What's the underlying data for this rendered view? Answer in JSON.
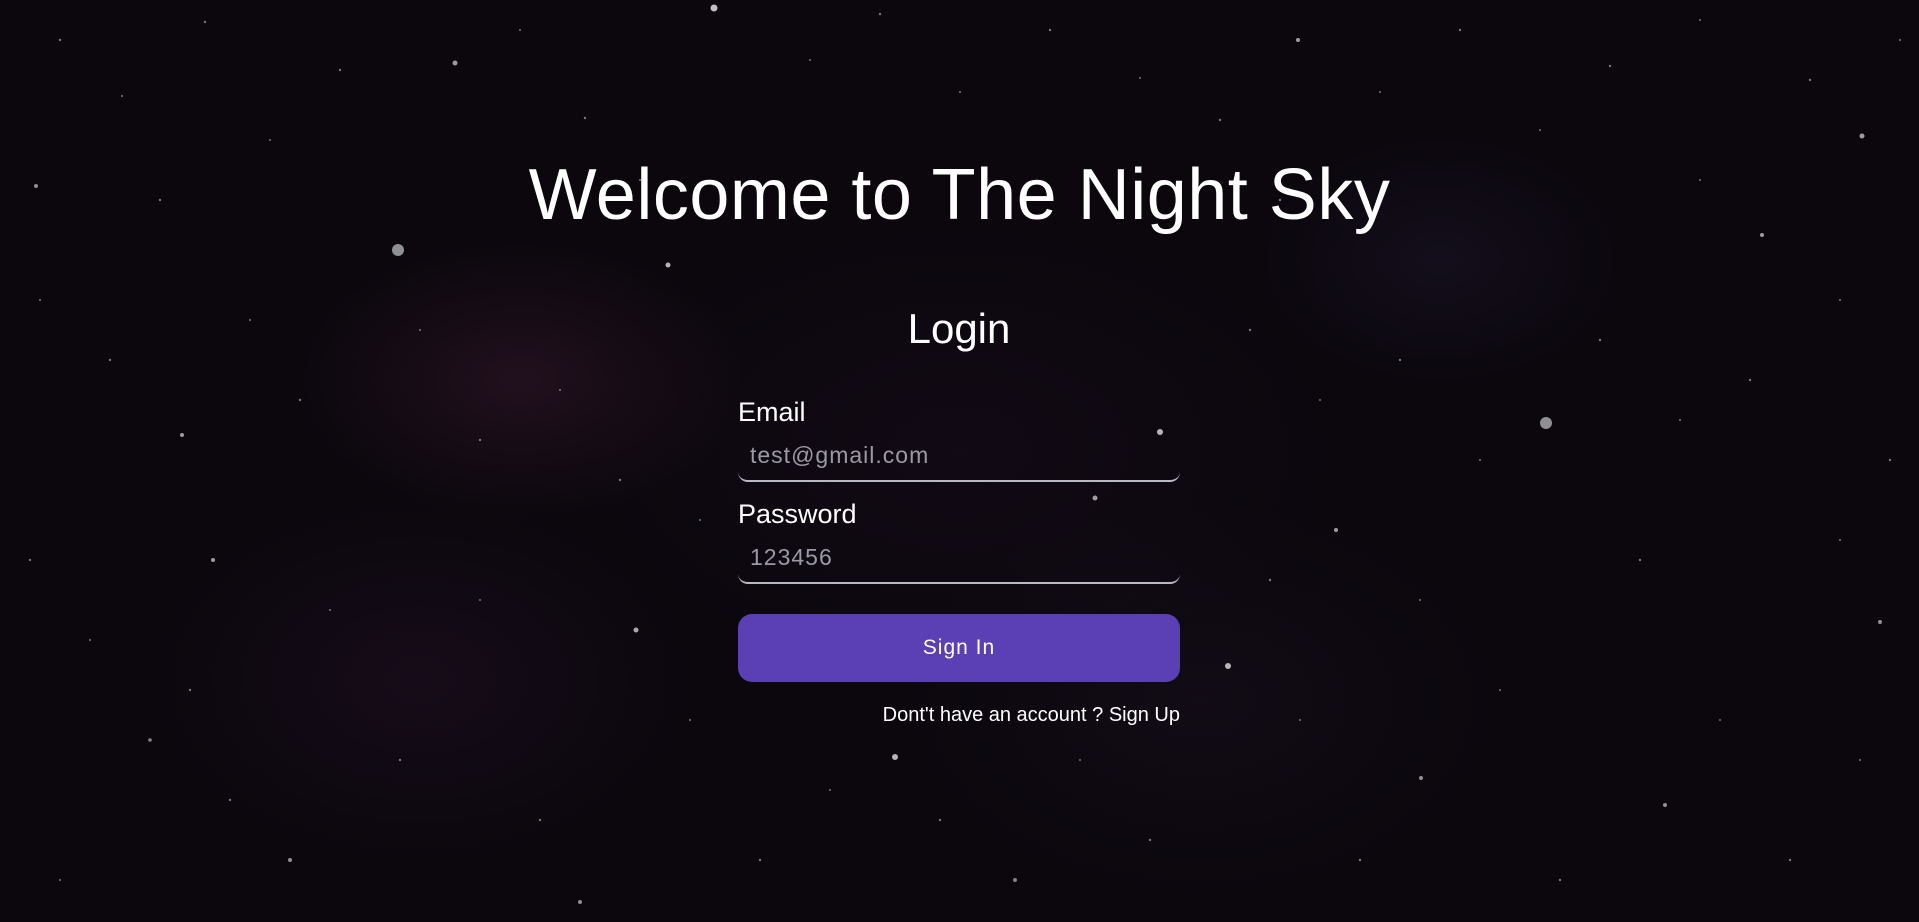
{
  "page": {
    "title": "Welcome to The Night Sky",
    "background_color": "#0b070d"
  },
  "login": {
    "heading": "Login",
    "email": {
      "label": "Email",
      "placeholder": "test@gmail.com",
      "value": ""
    },
    "password": {
      "label": "Password",
      "placeholder": "123456",
      "value": ""
    },
    "submit_label": "Sign In",
    "submit_color": "#5b3fb4",
    "signup_prompt": "Dont't have an account ?",
    "signup_link": "Sign Up"
  }
}
